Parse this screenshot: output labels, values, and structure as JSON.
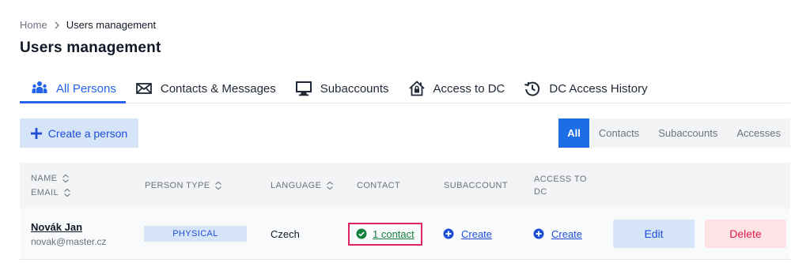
{
  "breadcrumb": {
    "home": "Home",
    "current": "Users management"
  },
  "page_title": "Users management",
  "tabs": [
    {
      "label": "All Persons",
      "icon": "users-icon",
      "active": true
    },
    {
      "label": "Contacts & Messages",
      "icon": "envelope-icon",
      "active": false
    },
    {
      "label": "Subaccounts",
      "icon": "monitor-icon",
      "active": false
    },
    {
      "label": "Access to DC",
      "icon": "house-lock-icon",
      "active": false
    },
    {
      "label": "DC Access History",
      "icon": "history-icon",
      "active": false
    }
  ],
  "toolbar": {
    "create_label": "Create a person"
  },
  "filters": [
    {
      "label": "All",
      "active": true
    },
    {
      "label": "Contacts",
      "active": false
    },
    {
      "label": "Subaccounts",
      "active": false
    },
    {
      "label": "Accesses",
      "active": false
    }
  ],
  "table": {
    "headers": {
      "name": "NAME",
      "email": "EMAIL",
      "person_type": "PERSON TYPE",
      "language": "LANGUAGE",
      "contact": "CONTACT",
      "subaccount": "SUBACCOUNT",
      "access_line1": "ACCESS TO",
      "access_line2": "DC"
    },
    "rows": [
      {
        "name": "Novák Jan",
        "email": "novak@master.cz",
        "person_type": "PHYSICAL",
        "language": "Czech",
        "contact": "1 contact",
        "subaccount": "Create",
        "access": "Create",
        "edit_label": "Edit",
        "delete_label": "Delete"
      }
    ]
  },
  "colors": {
    "accent": "#2563eb",
    "highlight_border": "#e0245e",
    "success": "#15803d",
    "danger": "#e11d48"
  }
}
